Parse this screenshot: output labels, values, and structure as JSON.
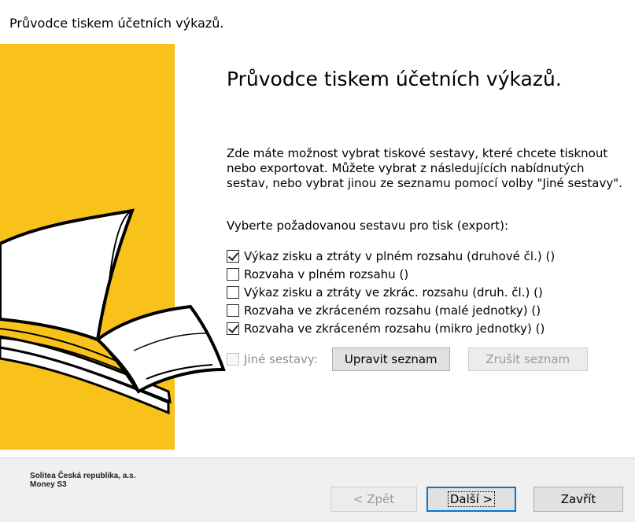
{
  "window": {
    "title": "Průvodce tiskem účetních výkazů."
  },
  "main": {
    "heading": "Průvodce tiskem účetních výkazů.",
    "description": "Zde máte možnost vybrat tiskové sestavy, které chcete tisknout nebo exportovat. Můžete vybrat z následujících nabídnutých sestav, nebo vybrat jinou ze seznamu pomocí volby \"Jiné sestavy\".",
    "prompt": "Vyberte požadovanou sestavu pro tisk (export):",
    "reports": [
      {
        "label": "Výkaz zisku a ztráty v plném rozsahu (druhové čl.) ()",
        "checked": true
      },
      {
        "label": "Rozvaha v plném rozsahu ()",
        "checked": false
      },
      {
        "label": "Výkaz zisku a ztráty ve zkrác. rozsahu (druh. čl.) ()",
        "checked": false
      },
      {
        "label": "Rozvaha ve zkráceném rozsahu (malé jednotky) ()",
        "checked": false
      },
      {
        "label": "Rozvaha ve zkráceném rozsahu (mikro jednotky) ()",
        "checked": true
      }
    ],
    "other_reports": {
      "label": "Jiné sestavy:",
      "checked": false,
      "enabled": false,
      "edit_button": "Upravit seznam",
      "clear_button": "Zrušit seznam"
    }
  },
  "footer": {
    "company_line1": "Solitea Česká republika, a.s.",
    "company_line2": "Money S3",
    "back_button": "< Zpět",
    "next_button": "Další >",
    "close_button": "Zavřít"
  },
  "colors": {
    "side_panel": "#f9c21a",
    "focus_border": "#0078d7"
  },
  "icons": {
    "side_illustration": "open-book-illustration"
  }
}
